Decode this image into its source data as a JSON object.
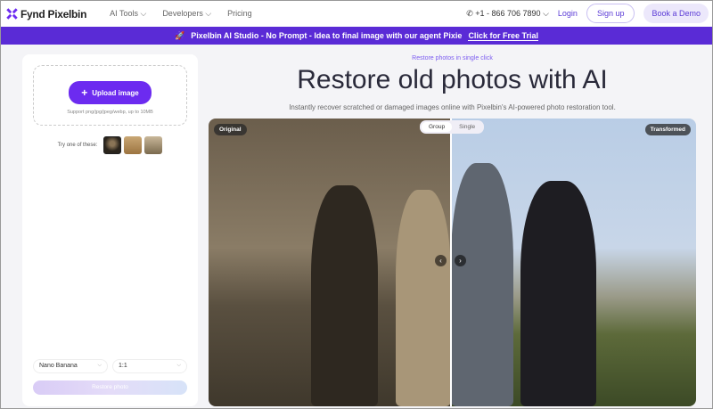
{
  "nav": {
    "brand": "Fynd Pixelbin",
    "menu": [
      "AI Tools",
      "Developers",
      "Pricing"
    ],
    "phone": "+1 - 866 706 7890",
    "login": "Login",
    "signup": "Sign up",
    "demo": "Book a Demo"
  },
  "banner": {
    "text": "Pixelbin AI Studio - No Prompt - Idea to final image with our agent Pixie",
    "cta": "Click for Free Trial"
  },
  "sidebar": {
    "upload": "Upload image",
    "support": "Support png/jpg/jpeg/webp, up to 10MB",
    "try": "Try one of these:",
    "model": "Nano Banana",
    "ratio": "1:1",
    "restore": "Restore photo"
  },
  "main": {
    "tagline": "Restore photos in single click",
    "title": "Restore old photos with AI",
    "subtitle": "Instantly recover scratched or damaged images online with Pixelbin's AI-powered photo restoration tool.",
    "original": "Original",
    "transformed": "Transformed",
    "tabs": [
      "Group",
      "Single"
    ]
  }
}
